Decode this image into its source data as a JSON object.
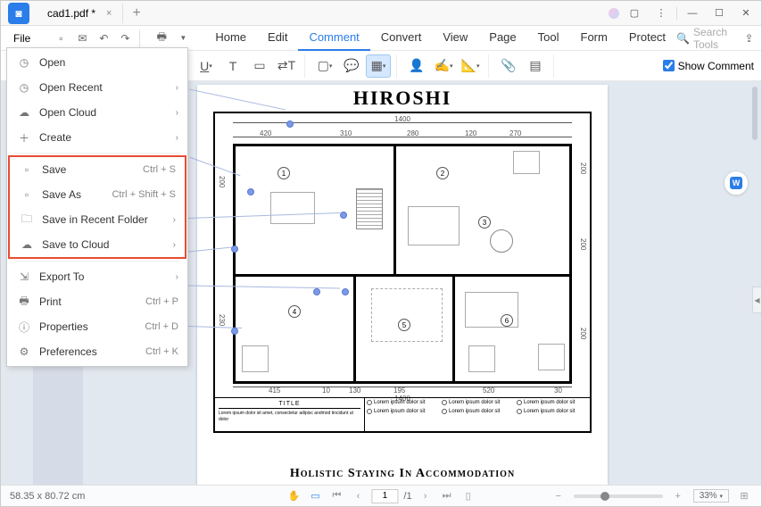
{
  "titlebar": {
    "tab_title": "cad1.pdf *",
    "tab_close": "×",
    "tab_add": "+"
  },
  "menubar": {
    "file": "File",
    "tabs": [
      "Home",
      "Edit",
      "Comment",
      "Convert",
      "View",
      "Page",
      "Tool",
      "Form",
      "Protect"
    ],
    "active_tab": 2,
    "search_placeholder": "Search Tools"
  },
  "toolbar": {
    "show_comment": "Show Comment"
  },
  "file_menu": {
    "items": [
      {
        "icon": "clock",
        "label": "Open",
        "shortcut": "",
        "chevron": false
      },
      {
        "icon": "clock",
        "label": "Open Recent",
        "shortcut": "",
        "chevron": true
      },
      {
        "icon": "cloud",
        "label": "Open Cloud",
        "shortcut": "",
        "chevron": true
      },
      {
        "icon": "plus",
        "label": "Create",
        "shortcut": "",
        "chevron": true
      }
    ],
    "save_items": [
      {
        "icon": "save",
        "label": "Save",
        "shortcut": "Ctrl + S",
        "chevron": false
      },
      {
        "icon": "saveas",
        "label": "Save As",
        "shortcut": "Ctrl + Shift + S",
        "chevron": false
      },
      {
        "icon": "folder",
        "label": "Save in Recent Folder",
        "shortcut": "",
        "chevron": true
      },
      {
        "icon": "cloud-up",
        "label": "Save to Cloud",
        "shortcut": "",
        "chevron": true
      }
    ],
    "bottom_items": [
      {
        "icon": "export",
        "label": "Export To",
        "shortcut": "",
        "chevron": true
      },
      {
        "icon": "print",
        "label": "Print",
        "shortcut": "Ctrl + P",
        "chevron": false
      },
      {
        "icon": "info",
        "label": "Properties",
        "shortcut": "Ctrl + D",
        "chevron": false
      },
      {
        "icon": "gear",
        "label": "Preferences",
        "shortcut": "Ctrl + K",
        "chevron": false
      }
    ]
  },
  "document": {
    "title": "HIROSHI",
    "subtitle": "Holistic Staying In Accommodation",
    "overall_dim": "1400",
    "dims_top": [
      "420",
      "310",
      "280",
      "120",
      "270"
    ],
    "dims_bottom": [
      "415",
      "10",
      "130",
      "195",
      "520",
      "30"
    ],
    "dim_left_top": "200",
    "dim_left_mid": "230",
    "dim_right_top": "200",
    "dim_right_mid": "200",
    "dim_right_bot": "200",
    "rooms": [
      "1",
      "2",
      "3",
      "4",
      "5",
      "6"
    ],
    "title_block_header": "TITLE",
    "title_block_text": "Lorem ipsum dolor sit amet, consectetur adipisc andmod tincidunt ut dolor",
    "legend_item": "Lorem ipsum dolor sit"
  },
  "statusbar": {
    "dimensions": "58.35 x 80.72 cm",
    "page_current": "1",
    "page_total": "/1",
    "zoom_pct": "33%"
  }
}
